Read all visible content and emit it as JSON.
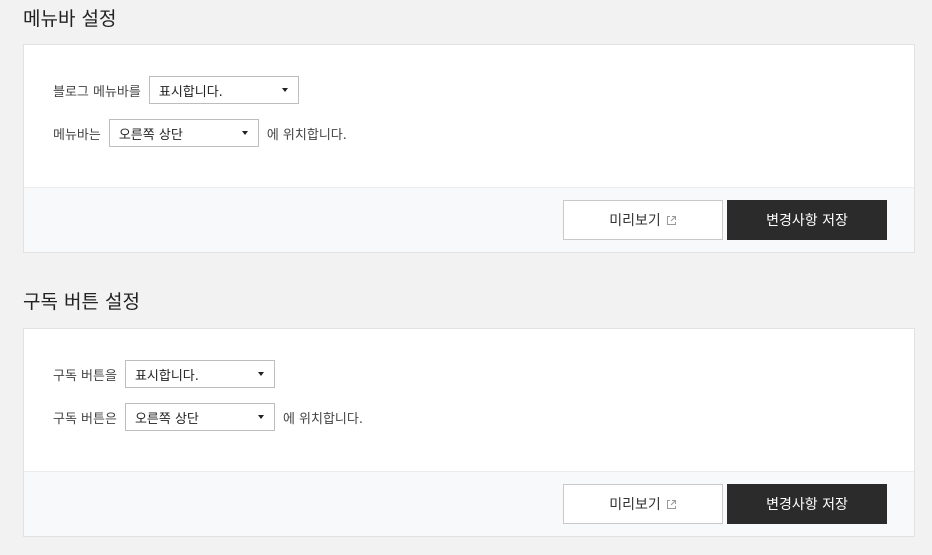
{
  "menubar_section": {
    "title": "메뉴바 설정",
    "row1": {
      "label": "블로그 메뉴바를",
      "select_value": "표시합니다."
    },
    "row2": {
      "label": "메뉴바는",
      "select_value": "오른쪽 상단",
      "suffix": "에 위치합니다."
    },
    "preview_label": "미리보기",
    "save_label": "변경사항 저장"
  },
  "subscribe_section": {
    "title": "구독 버튼 설정",
    "row1": {
      "label": "구독 버튼을",
      "select_value": "표시합니다."
    },
    "row2": {
      "label": "구독 버튼은",
      "select_value": "오른쪽 상단",
      "suffix": "에 위치합니다."
    },
    "preview_label": "미리보기",
    "save_label": "변경사항 저장"
  },
  "icons": {
    "dropdown": "caret-down-icon",
    "external": "external-link-icon"
  },
  "colors": {
    "save_bg": "#2b2b2b",
    "page_bg": "#f2f2f2",
    "footer_bg": "#f8f9fa"
  }
}
